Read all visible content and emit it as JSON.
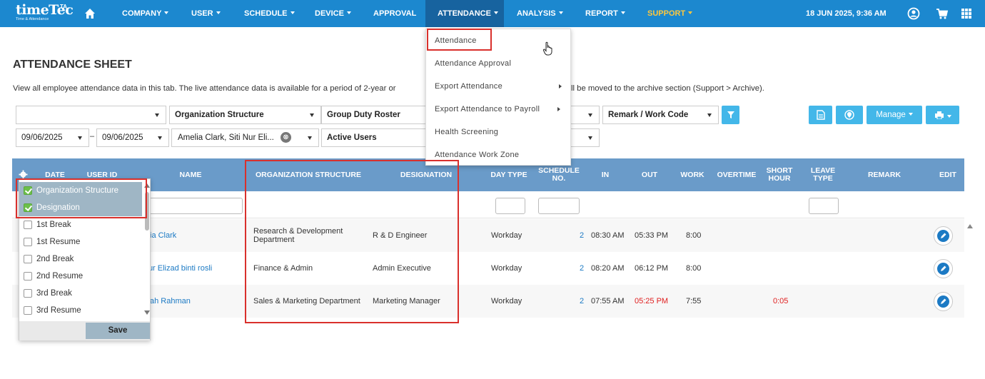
{
  "brand": {
    "logo": "timeTec",
    "logo_mark": "TA",
    "logo_sub": "Time & Attendance"
  },
  "nav": {
    "items": [
      "COMPANY",
      "USER",
      "SCHEDULE",
      "DEVICE",
      "APPROVAL",
      "ATTENDANCE",
      "ANALYSIS",
      "REPORT",
      "SUPPORT"
    ],
    "active": "ATTENDANCE",
    "datetime": "18 JUN 2025, 9:36 AM",
    "support_color": "#ffc83d",
    "bar_color": "#1c88cf",
    "icons": [
      "home-icon",
      "user-profile-icon",
      "cart-icon",
      "grid-menu-icon"
    ]
  },
  "attendance_menu": {
    "items": [
      "Attendance",
      "Attendance Approval",
      "Export Attendance",
      "Export Attendance to Payroll",
      "Health Screening",
      "Attendance Work Zone"
    ]
  },
  "page": {
    "title": "ATTENDANCE SHEET",
    "description_left": "View all employee attendance data in this tab. The live attendance data is available for a period of 2-year or",
    "description_right": "ll be moved to the archive section (Support > Archive)."
  },
  "filters": {
    "first_select": "",
    "organization": "Organization Structure",
    "roster": "Group Duty Roster",
    "remark": "Remark / Work Code",
    "date_from": "09/06/2025",
    "dash": "–",
    "date_to": "09/06/2025",
    "users": "Amelia Clark, Siti Nur Eli...",
    "clear_icon": "⊗",
    "status": "Active Users",
    "manage_label": "Manage",
    "accent": "#43b7e9"
  },
  "table": {
    "columns": [
      "DATE",
      "USER ID",
      "NAME",
      "ORGANIZATION STRUCTURE",
      "DESIGNATION",
      "DAY TYPE",
      "SCHEDULE NO.",
      "IN",
      "OUT",
      "WORK",
      "OVERTIME",
      "SHORT HOUR",
      "LEAVE TYPE",
      "REMARK",
      "EDIT"
    ],
    "header_color": "#6a9bc9",
    "rows": [
      {
        "name": "ia Clark",
        "org": "Research & Development Department",
        "designation": "R & D Engineer",
        "day_type": "Workday",
        "schedule": "2",
        "in": "08:30 AM",
        "out": "05:33 PM",
        "work": "8:00",
        "short": ""
      },
      {
        "name": "Nur Elizad binti rosli",
        "org": "Finance & Admin",
        "designation": "Admin Executive",
        "day_type": "Workday",
        "schedule": "2",
        "in": "08:20 AM",
        "out": "06:12 PM",
        "work": "8:00",
        "short": ""
      },
      {
        "name": "ah Rahman",
        "org": "Sales & Marketing Department",
        "designation": "Marketing Manager",
        "day_type": "Workday",
        "schedule": "2",
        "in": "07:55 AM",
        "out": "05:25 PM",
        "work": "7:55",
        "short": "0:05"
      }
    ]
  },
  "column_chooser": {
    "items": [
      {
        "label": "Organization Structure",
        "checked": true
      },
      {
        "label": "Designation",
        "checked": true
      },
      {
        "label": "1st Break",
        "checked": false
      },
      {
        "label": "1st Resume",
        "checked": false
      },
      {
        "label": "2nd Break",
        "checked": false
      },
      {
        "label": "2nd Resume",
        "checked": false
      },
      {
        "label": "3rd Break",
        "checked": false
      },
      {
        "label": "3rd Resume",
        "checked": false
      }
    ],
    "save_label": "Save"
  }
}
